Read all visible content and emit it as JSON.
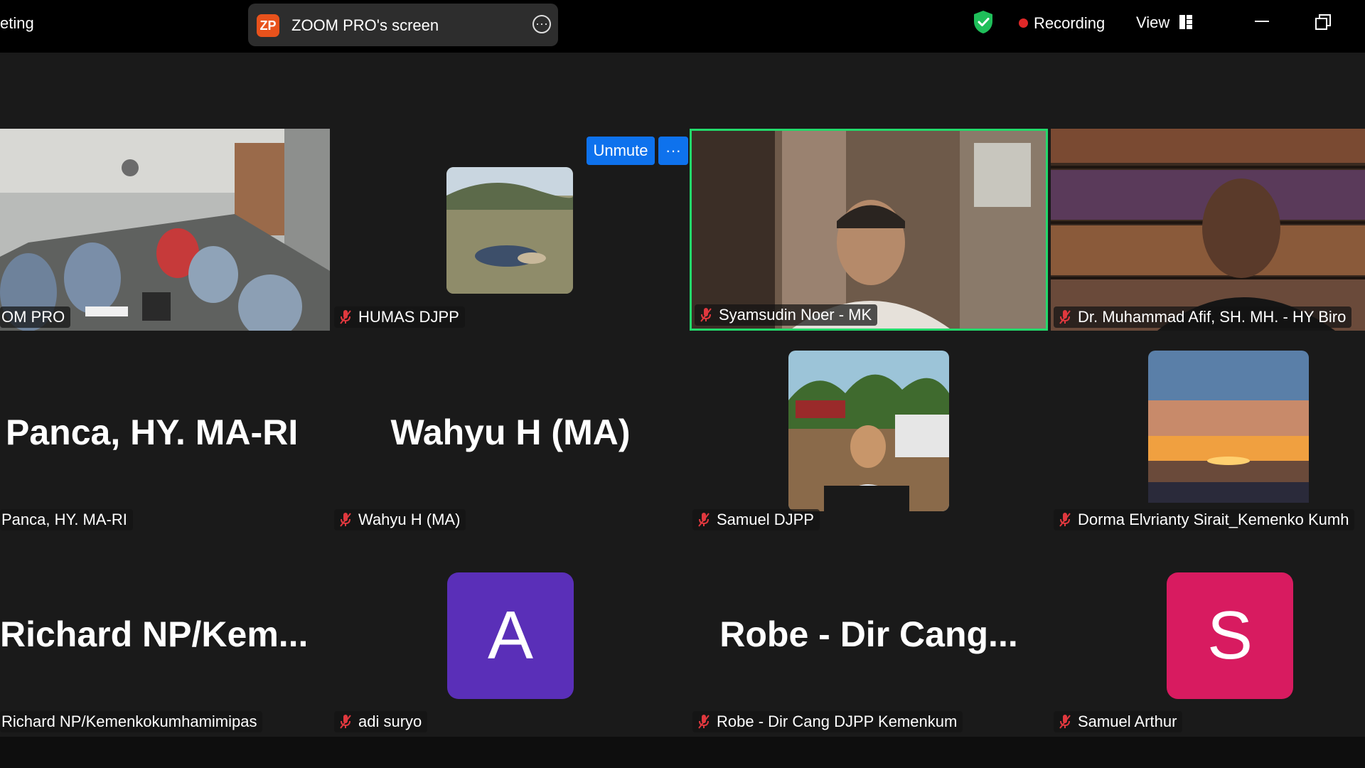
{
  "topbar": {
    "meeting_title_fragment": "eting",
    "share_avatar_initials": "ZP",
    "share_label": "ZOOM PRO's screen",
    "recording_label": "Recording",
    "view_label": "View"
  },
  "controls": {
    "unmute_label": "Unmute",
    "more_label": "···"
  },
  "tiles": [
    {
      "name": "OM PRO",
      "muted": false
    },
    {
      "name": "HUMAS DJPP",
      "muted": true
    },
    {
      "name": "Syamsudin Noer - MK",
      "muted": true,
      "active_speaker": true
    },
    {
      "name": "Dr. Muhammad Afif, SH. MH. - HY Biro",
      "muted": true
    },
    {
      "name": "Panca, HY. MA-RI",
      "big_name": "Panca, HY. MA-RI",
      "muted": false
    },
    {
      "name": "Wahyu H (MA)",
      "big_name": "Wahyu H (MA)",
      "muted": true
    },
    {
      "name": "Samuel DJPP",
      "muted": true
    },
    {
      "name": "Dorma Elvrianty Sirait_Kemenko Kumh",
      "muted": true
    },
    {
      "name": "Richard NP/Kemenkokumhamimipas",
      "big_name": "Richard  NP/Kem...",
      "muted": false
    },
    {
      "name": "adi suryo",
      "avatar_letter": "A",
      "avatar_color": "#5a2fb8",
      "muted": true
    },
    {
      "name": "Robe - Dir Cang DJPP Kemenkum",
      "big_name": "Robe  -  Dir  Cang...",
      "muted": true
    },
    {
      "name": "Samuel Arthur",
      "avatar_letter": "S",
      "avatar_color": "#d81b60",
      "muted": true
    }
  ],
  "colors": {
    "active_speaker_border": "#23d96b",
    "accent_blue": "#0e72ed",
    "recording_red": "#e02828",
    "shield_green": "#1fbf5a",
    "mute_red": "#e0383e"
  }
}
